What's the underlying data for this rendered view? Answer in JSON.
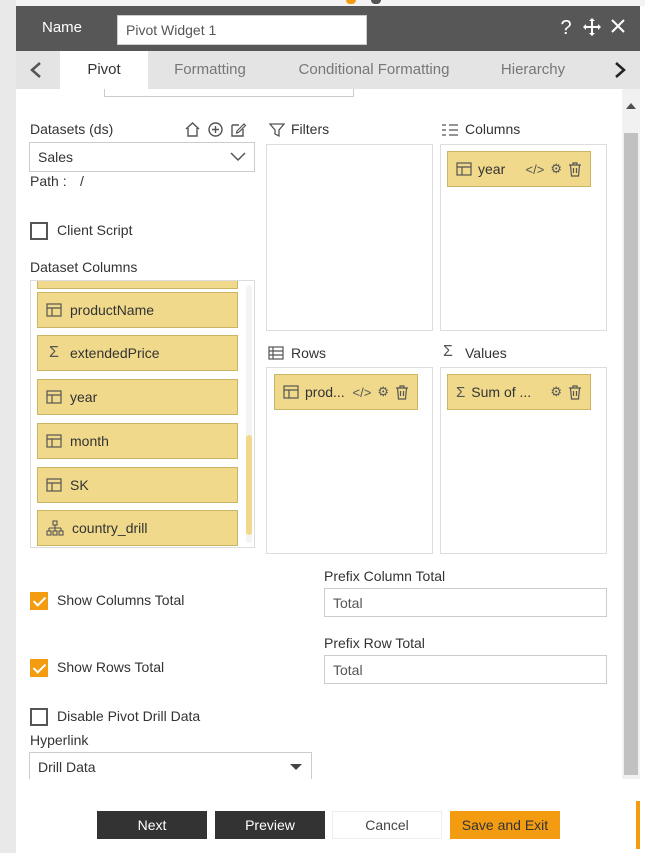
{
  "header": {
    "name_label": "Name",
    "widget_name": "Pivot Widget 1",
    "icons": [
      "question-icon",
      "move-icon",
      "close-icon"
    ]
  },
  "tabs": [
    {
      "label": "Pivot",
      "active": true
    },
    {
      "label": "Formatting",
      "active": false
    },
    {
      "label": "Conditional Formatting",
      "active": false
    },
    {
      "label": "Hierarchy",
      "active": false
    }
  ],
  "datasets": {
    "label": "Datasets (ds)",
    "selected": "Sales",
    "path_label": "Path :",
    "path_value": "/"
  },
  "client_script": {
    "label": "Client Script",
    "checked": false
  },
  "dataset_columns": {
    "label": "Dataset Columns",
    "items": [
      {
        "name": "productName",
        "icon": "table-icon"
      },
      {
        "name": "extendedPrice",
        "icon": "sigma-icon"
      },
      {
        "name": "year",
        "icon": "table-icon"
      },
      {
        "name": "month",
        "icon": "table-icon"
      },
      {
        "name": "SK",
        "icon": "table-icon"
      },
      {
        "name": "country_drill",
        "icon": "hierarchy-icon"
      }
    ]
  },
  "filters": {
    "label": "Filters"
  },
  "columns": {
    "label": "Columns",
    "chips": [
      {
        "text": "year"
      }
    ]
  },
  "rows": {
    "label": "Rows",
    "chips": [
      {
        "text": "prod..."
      }
    ]
  },
  "values": {
    "label": "Values",
    "chips": [
      {
        "text": "Sum of ..."
      }
    ]
  },
  "show_columns_total": {
    "label": "Show Columns Total",
    "checked": true
  },
  "show_rows_total": {
    "label": "Show Rows Total",
    "checked": true
  },
  "prefix_column_total": {
    "label": "Prefix Column Total",
    "value": "Total"
  },
  "prefix_row_total": {
    "label": "Prefix Row Total",
    "value": "Total"
  },
  "disable_pivot_drill": {
    "label": "Disable Pivot Drill Data",
    "checked": false
  },
  "hyperlink": {
    "label": "Hyperlink",
    "selected": "Drill Data"
  },
  "footer": {
    "next": "Next",
    "preview": "Preview",
    "cancel": "Cancel",
    "save_exit": "Save and Exit"
  },
  "colors": {
    "header_bg": "#575757",
    "accent": "#f39c12",
    "chip_bg": "#f0d98a",
    "button_dark": "#333333"
  }
}
